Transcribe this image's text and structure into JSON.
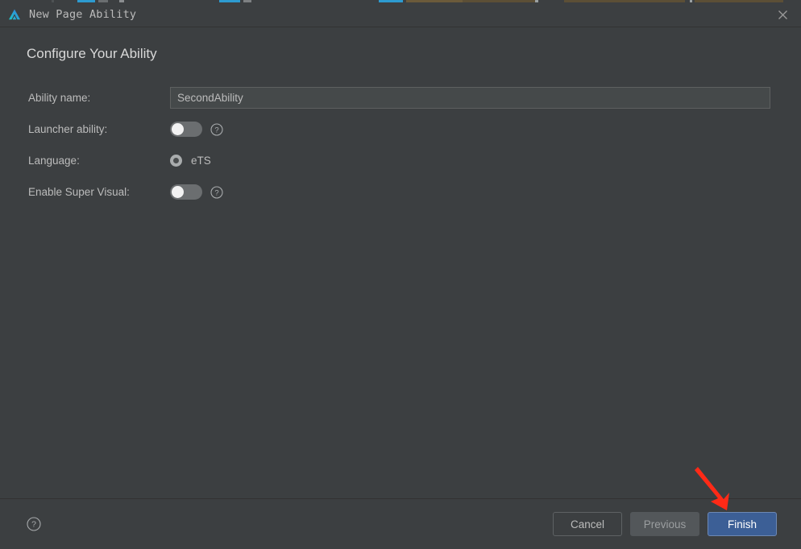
{
  "window": {
    "title": "New Page Ability",
    "logo_icon": "deveco-triangle-logo",
    "close_icon": "close-icon"
  },
  "content": {
    "heading": "Configure Your Ability",
    "fields": [
      {
        "label": "Ability name:",
        "type": "text",
        "value": "SecondAbility",
        "placeholder": ""
      },
      {
        "label": "Launcher ability:",
        "type": "toggle",
        "state": "off",
        "help_icon": "question-mark-icon"
      },
      {
        "label": "Language:",
        "type": "radio",
        "option": "eTS",
        "selected": true
      },
      {
        "label": "Enable Super Visual:",
        "type": "toggle",
        "state": "off",
        "help_icon": "question-mark-icon"
      }
    ]
  },
  "footer": {
    "help_icon": "question-mark-icon",
    "buttons": {
      "cancel": "Cancel",
      "previous": "Previous",
      "finish": "Finish"
    }
  },
  "annotation": {
    "arrow_color": "#FF2A17",
    "points_to": "finish-button"
  },
  "colors": {
    "background": "#3C3F41",
    "accent_blue": "#3C5F96",
    "text": "#BCBCBC",
    "heading_text": "#D8D8D8",
    "separator": "#323232"
  }
}
